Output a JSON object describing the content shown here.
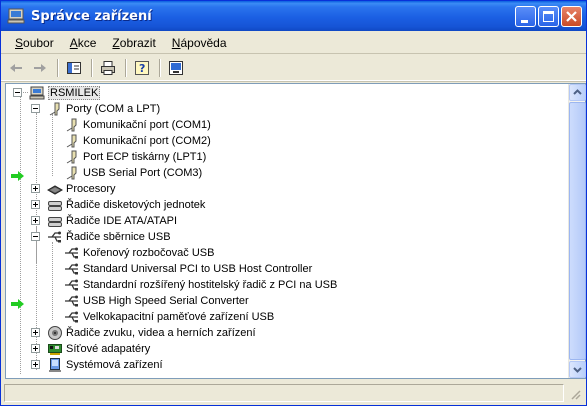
{
  "window": {
    "title": "Správce zařízení",
    "icon": "computer-icon"
  },
  "menu": [
    {
      "label": "Soubor",
      "accel": "S",
      "rest": "oubor"
    },
    {
      "label": "Akce",
      "accel": "A",
      "rest": "kce"
    },
    {
      "label": "Zobrazit",
      "accel": "Z",
      "rest": "obrazit"
    },
    {
      "label": "Nápověda",
      "accel": "N",
      "rest": "ápověda"
    }
  ],
  "toolbar": [
    "back-icon",
    "forward-icon",
    "show-hide-tree-icon",
    "print-icon",
    "help-icon",
    "refresh-view-icon"
  ],
  "tree": {
    "root": "RSMILEK",
    "ports": {
      "label": "Porty (COM a LPT)",
      "children": [
        "Komunikační port (COM1)",
        "Komunikační port (COM2)",
        "Port ECP tiskárny (LPT1)",
        "USB Serial Port (COM3)"
      ]
    },
    "processors": "Procesory",
    "floppy": "Řadiče disketových jednotek",
    "ide": "Řadiče IDE ATA/ATAPI",
    "usb": {
      "label": "Řadiče sběrnice USB",
      "children": [
        "Kořenový rozbočovač USB",
        "Standard Universal PCI to USB Host Controller",
        "Standardní rozšířený hostitelský řadič z PCI na USB",
        "USB High Speed Serial Converter",
        "Velkokapacitní paměťové zařízení USB"
      ]
    },
    "sound": "Řadiče zvuku, videa a herních zařízení",
    "network": "Síťové adapatéry",
    "system": "Systémová zařízení"
  },
  "colors": {
    "titlebar": "#1b5fe3",
    "highlight_arrow": "#22cc22",
    "window_bg": "#ece9d8"
  }
}
